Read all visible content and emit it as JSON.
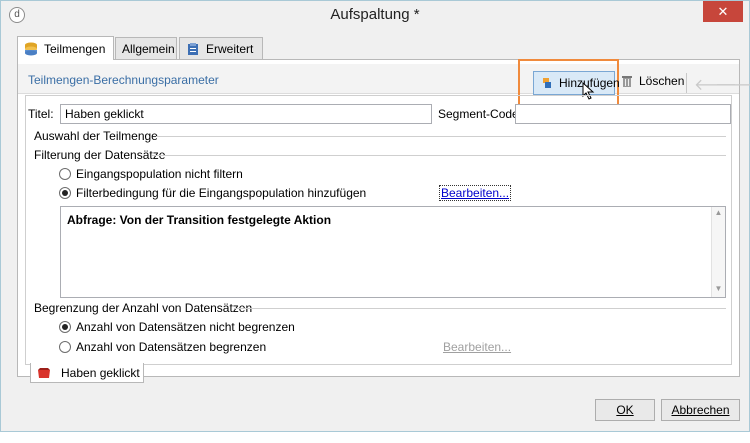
{
  "window": {
    "title": "Aufspaltung *",
    "close_glyph": "✕"
  },
  "tabs": [
    {
      "label": "Teilmengen",
      "icon": "stack-icon",
      "active": true
    },
    {
      "label": "Allgemein",
      "icon": "folder-icon",
      "active": false
    },
    {
      "label": "Erweitert",
      "icon": "clipboard-icon",
      "active": false
    }
  ],
  "section": {
    "title": "Teilmengen-Berechnungsparameter"
  },
  "toolbar": {
    "add_label": "Hinzufügen",
    "delete_label": "Löschen"
  },
  "form": {
    "title_label": "Titel:",
    "title_value": "Haben geklickt",
    "segment_label": "Segment-Code:",
    "segment_value": "",
    "subset_group": "Auswahl der Teilmenge",
    "filter_group": "Filterung der Datensätze",
    "filter_options": [
      {
        "label": "Eingangspopulation nicht filtern",
        "checked": false
      },
      {
        "label": "Filterbedingung für die Eingangspopulation hinzufügen",
        "checked": true
      }
    ],
    "edit_link": "Bearbeiten...",
    "query_text": "Abfrage: Von der Transition festgelegte Aktion",
    "limit_group": "Begrenzung der Anzahl von Datensätzen",
    "limit_options": [
      {
        "label": "Anzahl von Datensätzen nicht begrenzen",
        "checked": true
      },
      {
        "label": "Anzahl von Datensätzen begrenzen",
        "checked": false
      }
    ],
    "limit_edit_link": "Bearbeiten..."
  },
  "bottom_tab": {
    "label": "Haben geklickt"
  },
  "footer": {
    "ok_label": "OK",
    "cancel_label": "Abbrechen"
  },
  "colors": {
    "accent": "#3a6ea5",
    "highlight": "#f08a3c",
    "close": "#c7463b"
  }
}
